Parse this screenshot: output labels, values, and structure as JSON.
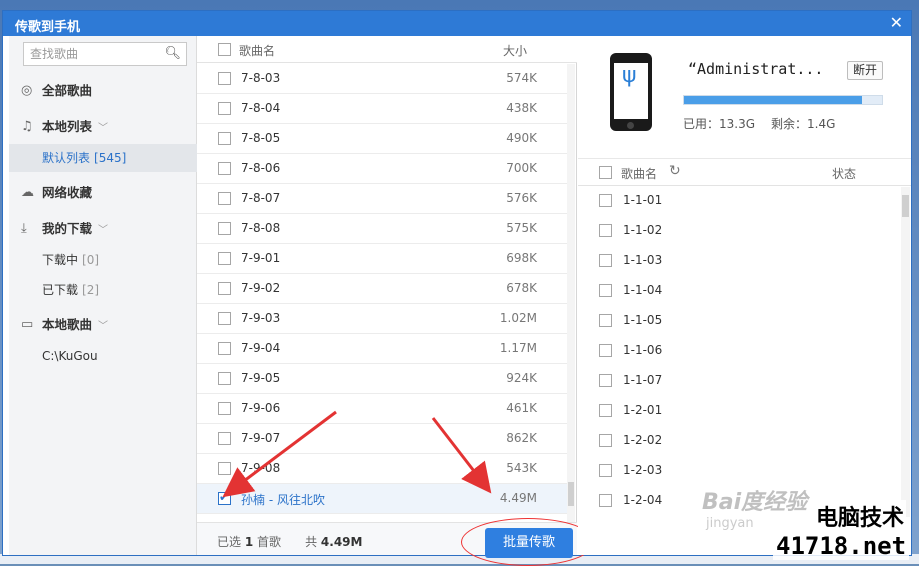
{
  "dialog": {
    "title": "传歌到手机",
    "close_glyph": "✕"
  },
  "sidebar": {
    "search_placeholder": "查找歌曲",
    "items": [
      {
        "label": "全部歌曲",
        "icon": "disc-icon"
      },
      {
        "label": "本地列表",
        "icon": "music-note-icon"
      },
      {
        "label": "默认列表",
        "count": "[545]"
      },
      {
        "label": "网络收藏",
        "icon": "cloud-icon"
      },
      {
        "label": "我的下载",
        "icon": "download-icon"
      },
      {
        "label": "下载中",
        "count": "[0]"
      },
      {
        "label": "已下载",
        "count": "[2]"
      },
      {
        "label": "本地歌曲",
        "icon": "monitor-icon"
      },
      {
        "label": "C:\\KuGou"
      }
    ]
  },
  "song_list": {
    "col_name": "歌曲名",
    "col_size": "大小",
    "rows": [
      {
        "name": "7-8-03",
        "size": "574K"
      },
      {
        "name": "7-8-04",
        "size": "438K"
      },
      {
        "name": "7-8-05",
        "size": "490K"
      },
      {
        "name": "7-8-06",
        "size": "700K"
      },
      {
        "name": "7-8-07",
        "size": "576K"
      },
      {
        "name": "7-8-08",
        "size": "575K"
      },
      {
        "name": "7-9-01",
        "size": "698K"
      },
      {
        "name": "7-9-02",
        "size": "678K"
      },
      {
        "name": "7-9-03",
        "size": "1.02M"
      },
      {
        "name": "7-9-04",
        "size": "1.17M"
      },
      {
        "name": "7-9-05",
        "size": "924K"
      },
      {
        "name": "7-9-06",
        "size": "461K"
      },
      {
        "name": "7-9-07",
        "size": "862K"
      },
      {
        "name": "7-9-08",
        "size": "543K"
      },
      {
        "name": "孙楠 - 风往北吹",
        "size": "4.49M",
        "checked": true
      }
    ],
    "footer": {
      "selected_pre": "已选",
      "selected_count": "1",
      "selected_post": "首歌",
      "total_pre": "共",
      "total": "4.49M"
    },
    "batch_button": "批量传歌"
  },
  "device": {
    "name": "“Administrat...",
    "disconnect_label": "断开",
    "usage_fraction": 0.9,
    "used_label": "已用：13.3G",
    "free_label": "剩余：1.4G",
    "col_name": "歌曲名",
    "col_status": "状态",
    "rows": [
      "1-1-01",
      "1-1-02",
      "1-1-03",
      "1-1-04",
      "1-1-05",
      "1-1-06",
      "1-1-07",
      "1-2-01",
      "1-2-02",
      "1-2-03",
      "1-2-04"
    ]
  },
  "watermarks": {
    "baidu": "Bai度经验",
    "jingyan": "jingyan",
    "site_cn": "电脑技术",
    "site_url": "41718.net"
  },
  "colors": {
    "accent": "#2f7fe0",
    "annotation": "#e33333"
  }
}
